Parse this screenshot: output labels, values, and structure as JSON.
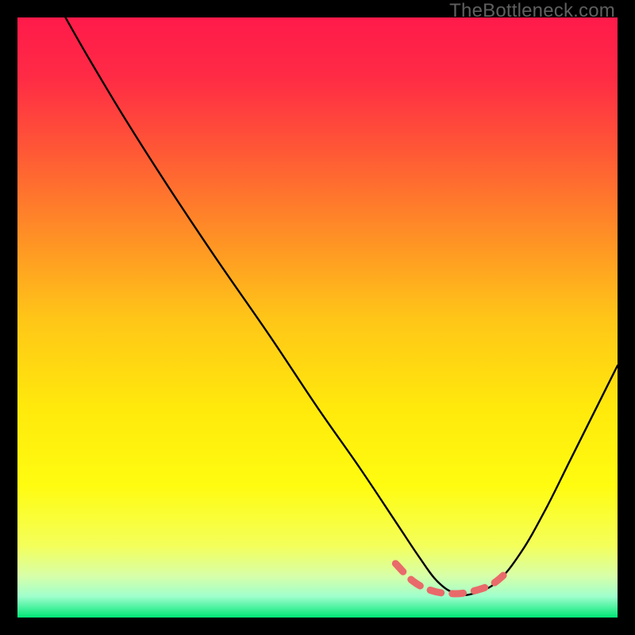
{
  "watermark": "TheBottleneck.com",
  "chart_data": {
    "type": "line",
    "title": "",
    "xlabel": "",
    "ylabel": "",
    "xlim": [
      0,
      100
    ],
    "ylim": [
      0,
      100
    ],
    "background_gradient": {
      "stops": [
        {
          "offset": 0.0,
          "color": "#ff1a4a"
        },
        {
          "offset": 0.1,
          "color": "#ff2b45"
        },
        {
          "offset": 0.22,
          "color": "#ff5736"
        },
        {
          "offset": 0.35,
          "color": "#ff8a27"
        },
        {
          "offset": 0.5,
          "color": "#ffc518"
        },
        {
          "offset": 0.65,
          "color": "#ffe90c"
        },
        {
          "offset": 0.78,
          "color": "#fffc10"
        },
        {
          "offset": 0.88,
          "color": "#f4ff5a"
        },
        {
          "offset": 0.93,
          "color": "#d8ffa8"
        },
        {
          "offset": 0.965,
          "color": "#9fffcd"
        },
        {
          "offset": 1.0,
          "color": "#00e676"
        }
      ]
    },
    "curve": {
      "description": "Bottleneck V-curve; minimum near x≈73, rising steeply toward x=0 and moderately toward x=100.",
      "x": [
        8,
        12,
        18,
        25,
        33,
        42,
        50,
        57,
        63,
        67,
        70,
        73,
        76,
        80,
        84,
        88,
        92,
        96,
        100
      ],
      "y": [
        100,
        93,
        83,
        72,
        60,
        47,
        35,
        25,
        16,
        10,
        6,
        4,
        4,
        6,
        11,
        18,
        26,
        34,
        42
      ]
    },
    "markers": {
      "description": "Dashed salmon segment marking low-bottleneck zone around the minimum",
      "x": [
        63,
        66,
        69,
        72,
        75,
        79,
        82
      ],
      "y": [
        9,
        6,
        4.5,
        4,
        4.2,
        5.5,
        8
      ]
    }
  }
}
